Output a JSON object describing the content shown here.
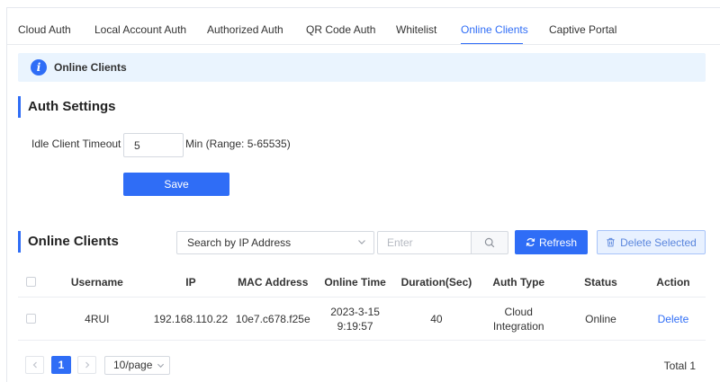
{
  "tabs": [
    {
      "label": "Cloud Auth"
    },
    {
      "label": "Local Account Auth"
    },
    {
      "label": "Authorized Auth"
    },
    {
      "label": "QR Code Auth"
    },
    {
      "label": "Whitelist"
    },
    {
      "label": "Online Clients",
      "active": true
    },
    {
      "label": "Captive Portal"
    }
  ],
  "info": {
    "text": "Online Clients"
  },
  "auth_settings": {
    "title": "Auth Settings",
    "timeout_label": "Idle Client Timeout",
    "timeout_value": "5",
    "timeout_hint": "Min (Range: 5-65535)",
    "save_label": "Save"
  },
  "clients": {
    "title": "Online Clients",
    "search_by": "Search by IP Address",
    "search_placeholder": "Enter",
    "refresh_label": "Refresh",
    "delete_label": "Delete Selected",
    "columns": [
      "Username",
      "IP",
      "MAC Address",
      "Online Time",
      "Duration(Sec)",
      "Auth Type",
      "Status",
      "Action"
    ],
    "rows": [
      {
        "username": "4RUI",
        "ip": "192.168.110.22",
        "mac": "10e7.c678.f25e",
        "online_date": "2023-3-15",
        "online_time": "9:19:57",
        "duration": "40",
        "auth_type_1": "Cloud",
        "auth_type_2": "Integration",
        "status": "Online",
        "action": "Delete"
      }
    ]
  },
  "pagination": {
    "current_page": "1",
    "page_size": "10/page",
    "total": "Total 1"
  },
  "colors": {
    "accent": "#2f6df6",
    "info_bg": "#eaf4fe"
  }
}
